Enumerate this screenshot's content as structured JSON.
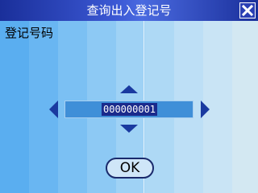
{
  "window": {
    "title": "查询出入登记号",
    "close_icon": "close-icon"
  },
  "form": {
    "field_label": "登记号码",
    "value": "000000001",
    "up_icon": "arrow-up-icon",
    "down_icon": "arrow-down-icon",
    "left_icon": "arrow-left-icon",
    "right_icon": "arrow-right-icon"
  },
  "buttons": {
    "ok_label": "OK"
  },
  "colors": {
    "title_bar": "#2a44c0",
    "arrow": "#1a3aa0",
    "input_bg": "#3f8fd8",
    "selection_bg": "#1a2a8c"
  }
}
